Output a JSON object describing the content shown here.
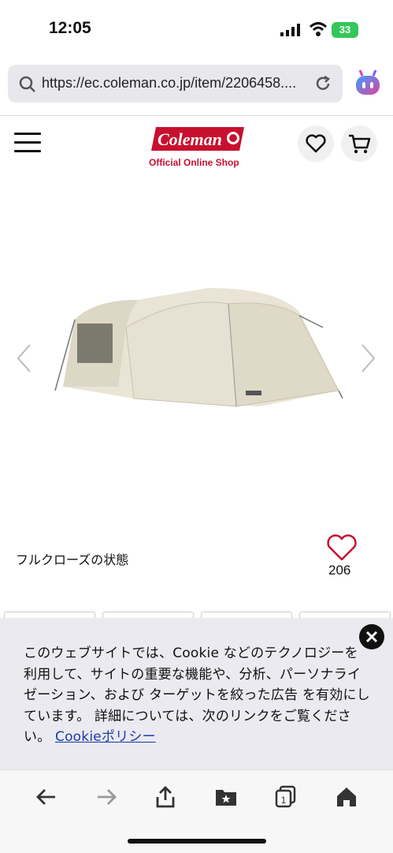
{
  "status_bar": {
    "time": "12:05",
    "battery": "33"
  },
  "browser": {
    "url": "https://ec.coleman.co.jp/item/2206458...."
  },
  "site": {
    "logo_text": "Coleman",
    "subtitle": "Official Online Shop"
  },
  "product": {
    "caption": "フルクローズの状態",
    "like_count": "206"
  },
  "cookie_banner": {
    "text": "このウェブサイトでは、Cookie などのテクノロジーを利用して、サイトの重要な機能や、分析、パーソナライゼーション、および ターゲットを絞った広告 を有効にしています。 詳細については、次のリンクをご覧ください。",
    "link_label": "Cookieポリシー"
  },
  "toolbar": {
    "tabs_count": "1"
  },
  "colors": {
    "brand_red": "#c8102e",
    "cookie_bg": "#eaeaf0",
    "link_blue": "#1a3aa8"
  }
}
